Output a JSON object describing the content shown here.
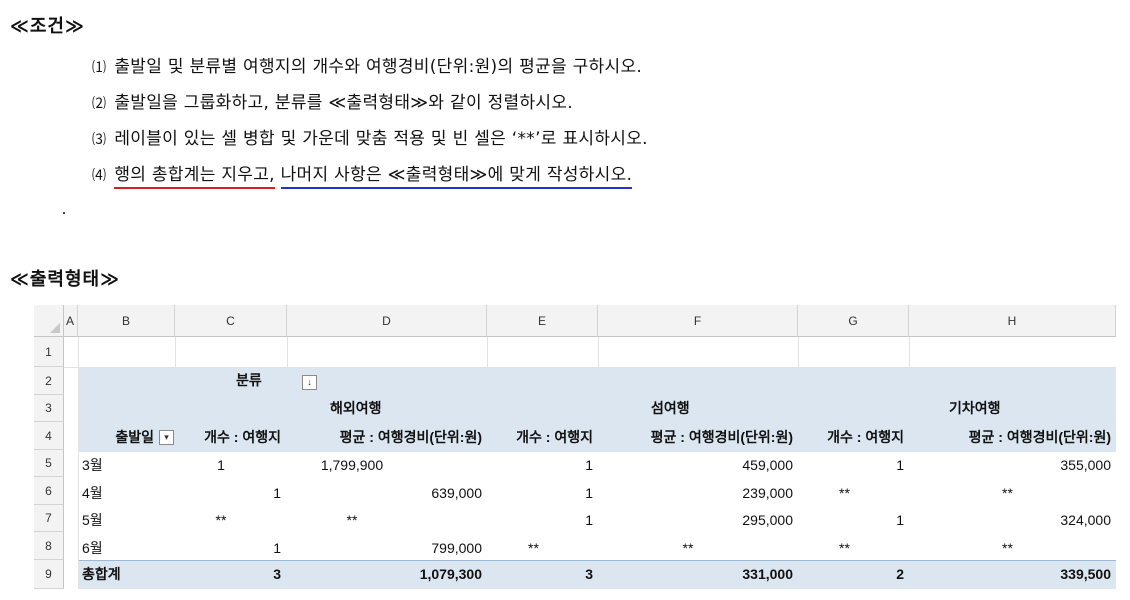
{
  "conditions_header": "≪조건≫",
  "conditions": [
    {
      "num": "⑴",
      "text": "출발일 및 분류별 여행지의 개수와 여행경비(단위:원)의 평균을 구하시오."
    },
    {
      "num": "⑵",
      "text": "출발일을 그룹화하고, 분류를 ≪출력형태≫와 같이 정렬하시오."
    },
    {
      "num": "⑶",
      "text": "레이블이 있는 셀 병합 및 가운데 맞춤 적용 및 빈 셀은 ‘**’로 표시하시오."
    },
    {
      "num": "⑷",
      "text_red": "행의 총합계는 지우고,",
      "text_blue": "나머지 사항은 ≪출력형태≫에 맞게 작성하시오."
    }
  ],
  "output_header": "≪출력형태≫",
  "sheet": {
    "columns": [
      "A",
      "B",
      "C",
      "D",
      "E",
      "F",
      "G",
      "H"
    ],
    "row_numbers": [
      "1",
      "2",
      "3",
      "4",
      "5",
      "6",
      "7",
      "8",
      "9"
    ],
    "pivot": {
      "category_label": "분류",
      "filter_symbol": "↓",
      "groups": [
        "해외여행",
        "섬여행",
        "기차여행"
      ],
      "row_field": "출발일",
      "count_header": "개수 : 여행지",
      "avg_header": "평균 : 여행경비(단위:원)",
      "rows": [
        {
          "label": "3월",
          "cells": [
            "1",
            "1,799,900",
            "1",
            "459,000",
            "1",
            "355,000"
          ]
        },
        {
          "label": "4월",
          "cells": [
            "1",
            "639,000",
            "1",
            "239,000",
            "**",
            "**"
          ]
        },
        {
          "label": "5월",
          "cells": [
            "**",
            "**",
            "1",
            "295,000",
            "1",
            "324,000"
          ]
        },
        {
          "label": "6월",
          "cells": [
            "1",
            "799,000",
            "**",
            "**",
            "**",
            "**"
          ]
        }
      ],
      "total": {
        "label": "총합계",
        "cells": [
          "3",
          "1,079,300",
          "3",
          "331,000",
          "2",
          "339,500"
        ]
      }
    }
  }
}
